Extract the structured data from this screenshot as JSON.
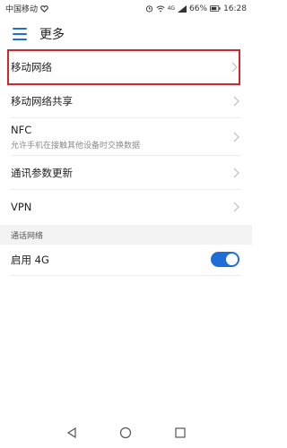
{
  "status_bar": {
    "carrier": "中国移动",
    "battery_percent": "66%",
    "time": "16:28",
    "signal_text": "4G"
  },
  "header": {
    "title": "更多"
  },
  "items": [
    {
      "label": "移动网络"
    },
    {
      "label": "移动网络共享"
    },
    {
      "label": "NFC",
      "sub": "允许手机在接触其他设备时交换数据"
    },
    {
      "label": "通讯参数更新"
    },
    {
      "label": "VPN"
    }
  ],
  "section": {
    "label": "通话网络"
  },
  "toggle_item": {
    "label": "启用 4G",
    "enabled": true
  },
  "colors": {
    "accent": "#1e6ed8",
    "highlight": "#d0272e"
  }
}
